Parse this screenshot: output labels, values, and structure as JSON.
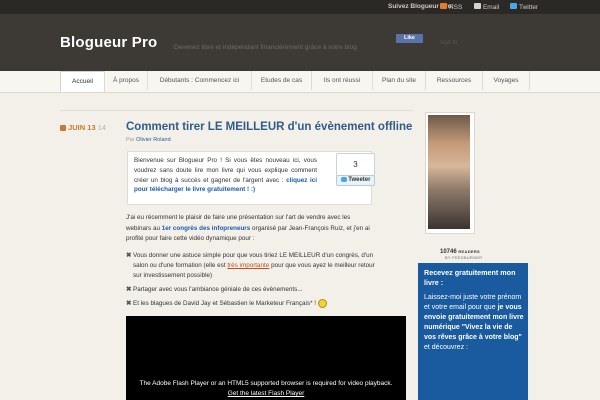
{
  "topbar": {
    "follow_label": "Suivez Blogueur Pro:",
    "rss": "RSS",
    "email": "Email",
    "twitter": "Twitter"
  },
  "site": {
    "title": "Blogueur Pro",
    "tagline": "Devenez libre et indépendant financièrement grâce à votre blog",
    "fb_like": "Like",
    "signin": "sign in"
  },
  "nav": [
    "Accueil",
    "À propos",
    "Débutants : Commencez ici",
    "Etudes de cas",
    "Ils ont réussi",
    "Plan du site",
    "Ressources",
    "Voyages"
  ],
  "post": {
    "date_month": "JUIN",
    "date_day": "13",
    "date_year": "14",
    "title": "Comment tirer LE MEILLEUR d'un évènement offline",
    "by": "Par",
    "author": "Olivier Roland",
    "intro_text": "Bienvenue sur Blogueur Pro ! Si vous êtes nouveau ici, vous voudrez sans doute lire mon livre qui vous explique comment créer un blog à succès et gagner de l'argent avec :",
    "intro_link": "cliquez ici pour télécharger le livre gratuitement ! :)",
    "tweet_count": "3",
    "tweet_label": "Tweeter",
    "para_a": "J'ai eu récemment le plaisir de faire une présentation sur l'art de vendre avec les webinars au",
    "para_link": "1er congrès des infopreneurs",
    "para_b": "organisé par Jean-François Ruiz, et j'en ai profité pour faire cette vidéo dynamique pour :",
    "bullets": [
      {
        "a": "Vous donner une astuce simple pour que vous tiriez LE MEILLEUR d'un congrès, d'un salon ou d'une formation (elle est",
        "u": "très importante",
        "b": "pour que vous ayez le meilleur retour sur investissement possible)"
      },
      {
        "a": "Partager avec vous l'ambiance géniale de ces évènements...",
        "u": "",
        "b": ""
      },
      {
        "a": "Et les blagues de David Jay et Sébastien le Marketeur Français* !",
        "u": "",
        "b": ""
      }
    ],
    "video_msg": "The Adobe Flash Player or an HTML5 supported browser is required for video playback.",
    "video_link": "Get the latest Flash Player"
  },
  "sidebar": {
    "readers_count": "10746",
    "readers_label": "READERS",
    "feedburner": "BY FEEDBURNER",
    "cta_title": "Recevez gratuitement mon livre :",
    "cta_1": "Laissez-moi juste votre prénom et votre email pour que",
    "cta_2": "je vous envoie gratuitement mon livre numérique \"Vivez la vie de vos rêves grâce à votre blog\"",
    "cta_3": "et découvrez :"
  },
  "colors": {
    "header": "#3d3a35",
    "accent_link": "#2e5c8a",
    "cta_bg": "#1a5a9e",
    "date": "#c87a33"
  }
}
